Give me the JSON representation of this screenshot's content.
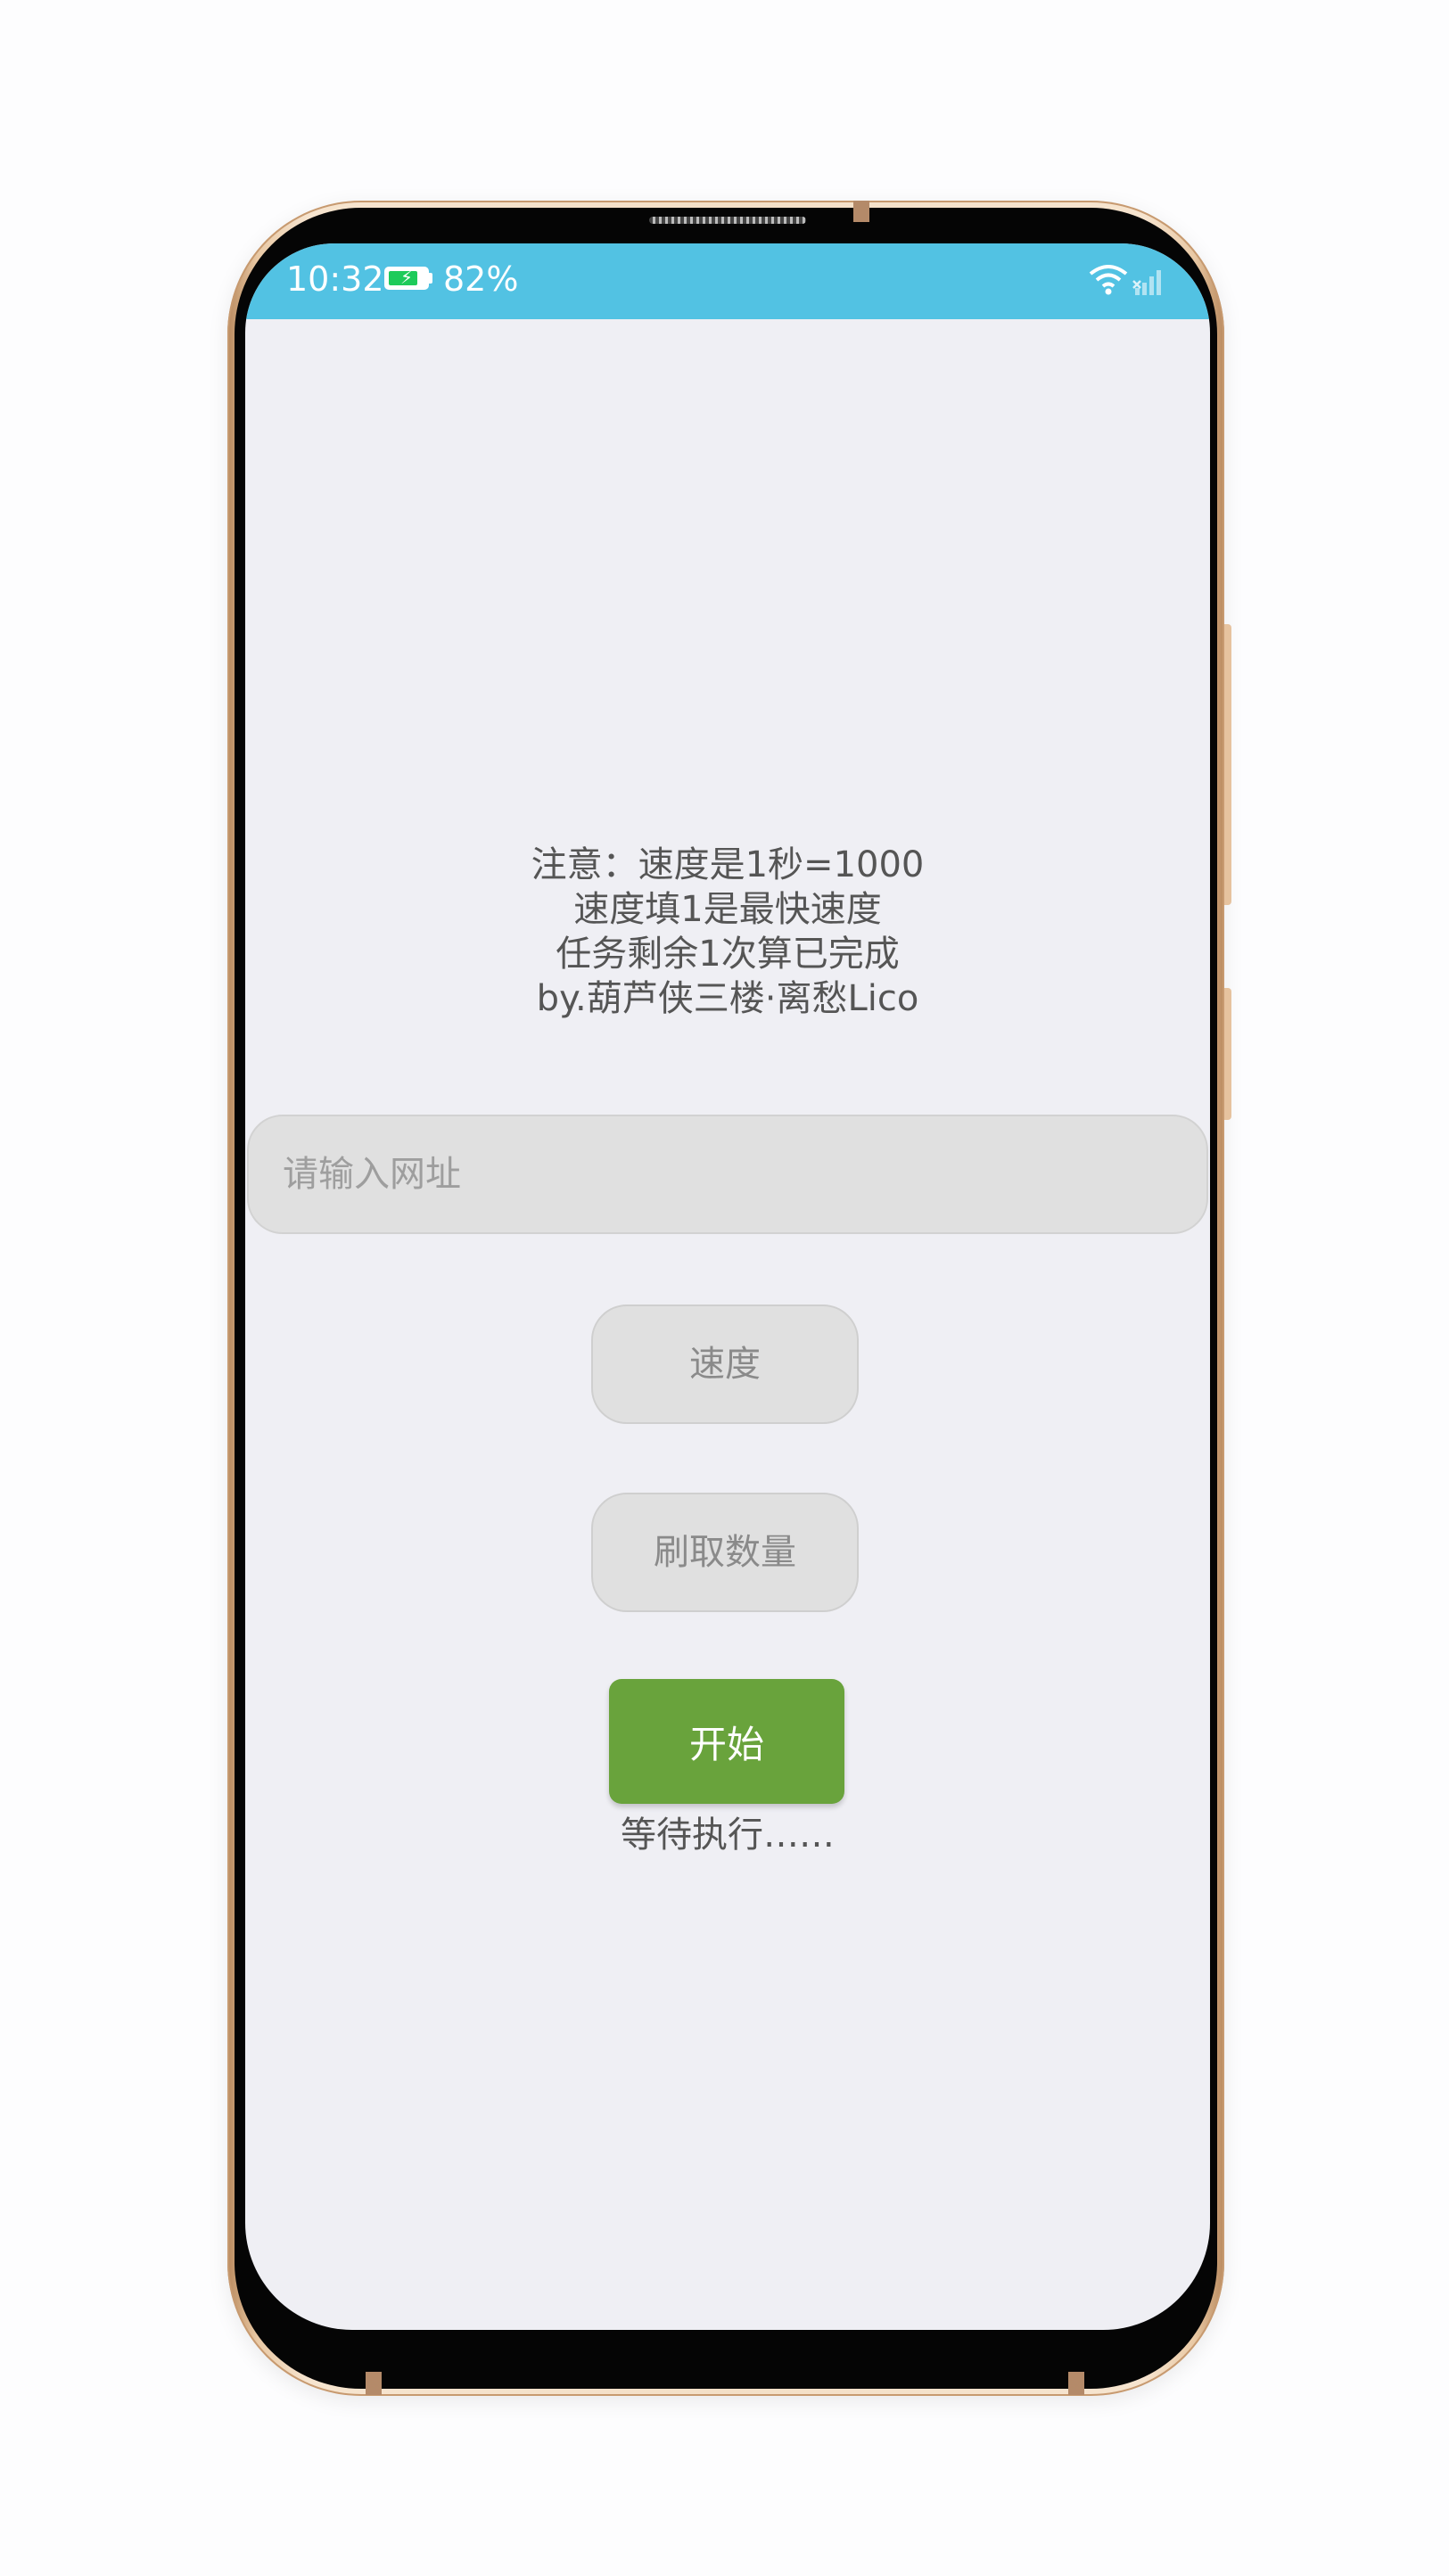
{
  "status_bar": {
    "time": "10:32",
    "battery_percent": "82%",
    "battery_level": 0.82,
    "background_color": "#52c2e3",
    "icons": [
      "battery-charging-icon",
      "wifi-icon",
      "cellular-signal-icon"
    ]
  },
  "info": {
    "line1": "注意：速度是1秒=1000",
    "line2": "速度填1是最快速度",
    "line3": "任务剩余1次算已完成",
    "line4": "by.葫芦侠三楼·离愁Lico"
  },
  "form": {
    "url_placeholder": "请输入网址",
    "speed_placeholder": "速度",
    "count_placeholder": "刷取数量"
  },
  "start_button": {
    "label": "开始",
    "color": "#69a33c"
  },
  "status": {
    "text": "等待执行……"
  }
}
